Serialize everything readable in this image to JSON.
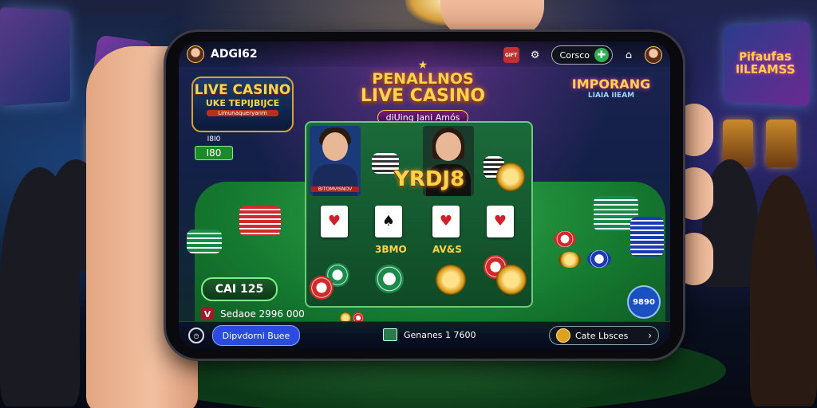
{
  "header": {
    "username": "ADGI62",
    "coins_label": "Corsco",
    "icons": [
      "avatar-icon",
      "gift-icon",
      "settings-icon",
      "plus-icon",
      "home-icon",
      "profile-icon"
    ]
  },
  "logos": {
    "main_line1": "PENALLNOS",
    "main_line2": "LIVE CASINO",
    "main_ribbon": "diUing Jani Amós",
    "left_line1": "LIVE CASINO",
    "left_line2": "UKE TEPIJBIJCE",
    "left_line3": "Limunaqueryanm",
    "right_line1": "IMPORANG",
    "right_line2": "LIAIA IIEAM"
  },
  "score_box": {
    "label": "I8I0",
    "value": "I80"
  },
  "game": {
    "title": "YRDJ8",
    "dealer_tag": "BITOMVISNOV",
    "player_labels": [
      "3BMO",
      "AV&S"
    ]
  },
  "controls": {
    "bet_amount": "CAI 125",
    "balance": "Sedaoe 2996 000",
    "round_button": "9890"
  },
  "bottombar": {
    "nav_button": "Dipvdorni Buee",
    "center_text": "Genanes 1 7600",
    "right_text": "Cate Lbsces"
  },
  "background": {
    "sign_left": "LIV CA",
    "sign_right": "Pifaufas IILEAMSS"
  },
  "colors": {
    "accent_gold": "#ffd34a",
    "felt_green": "#1f8a3a",
    "primary_blue": "#2a4ae0"
  }
}
